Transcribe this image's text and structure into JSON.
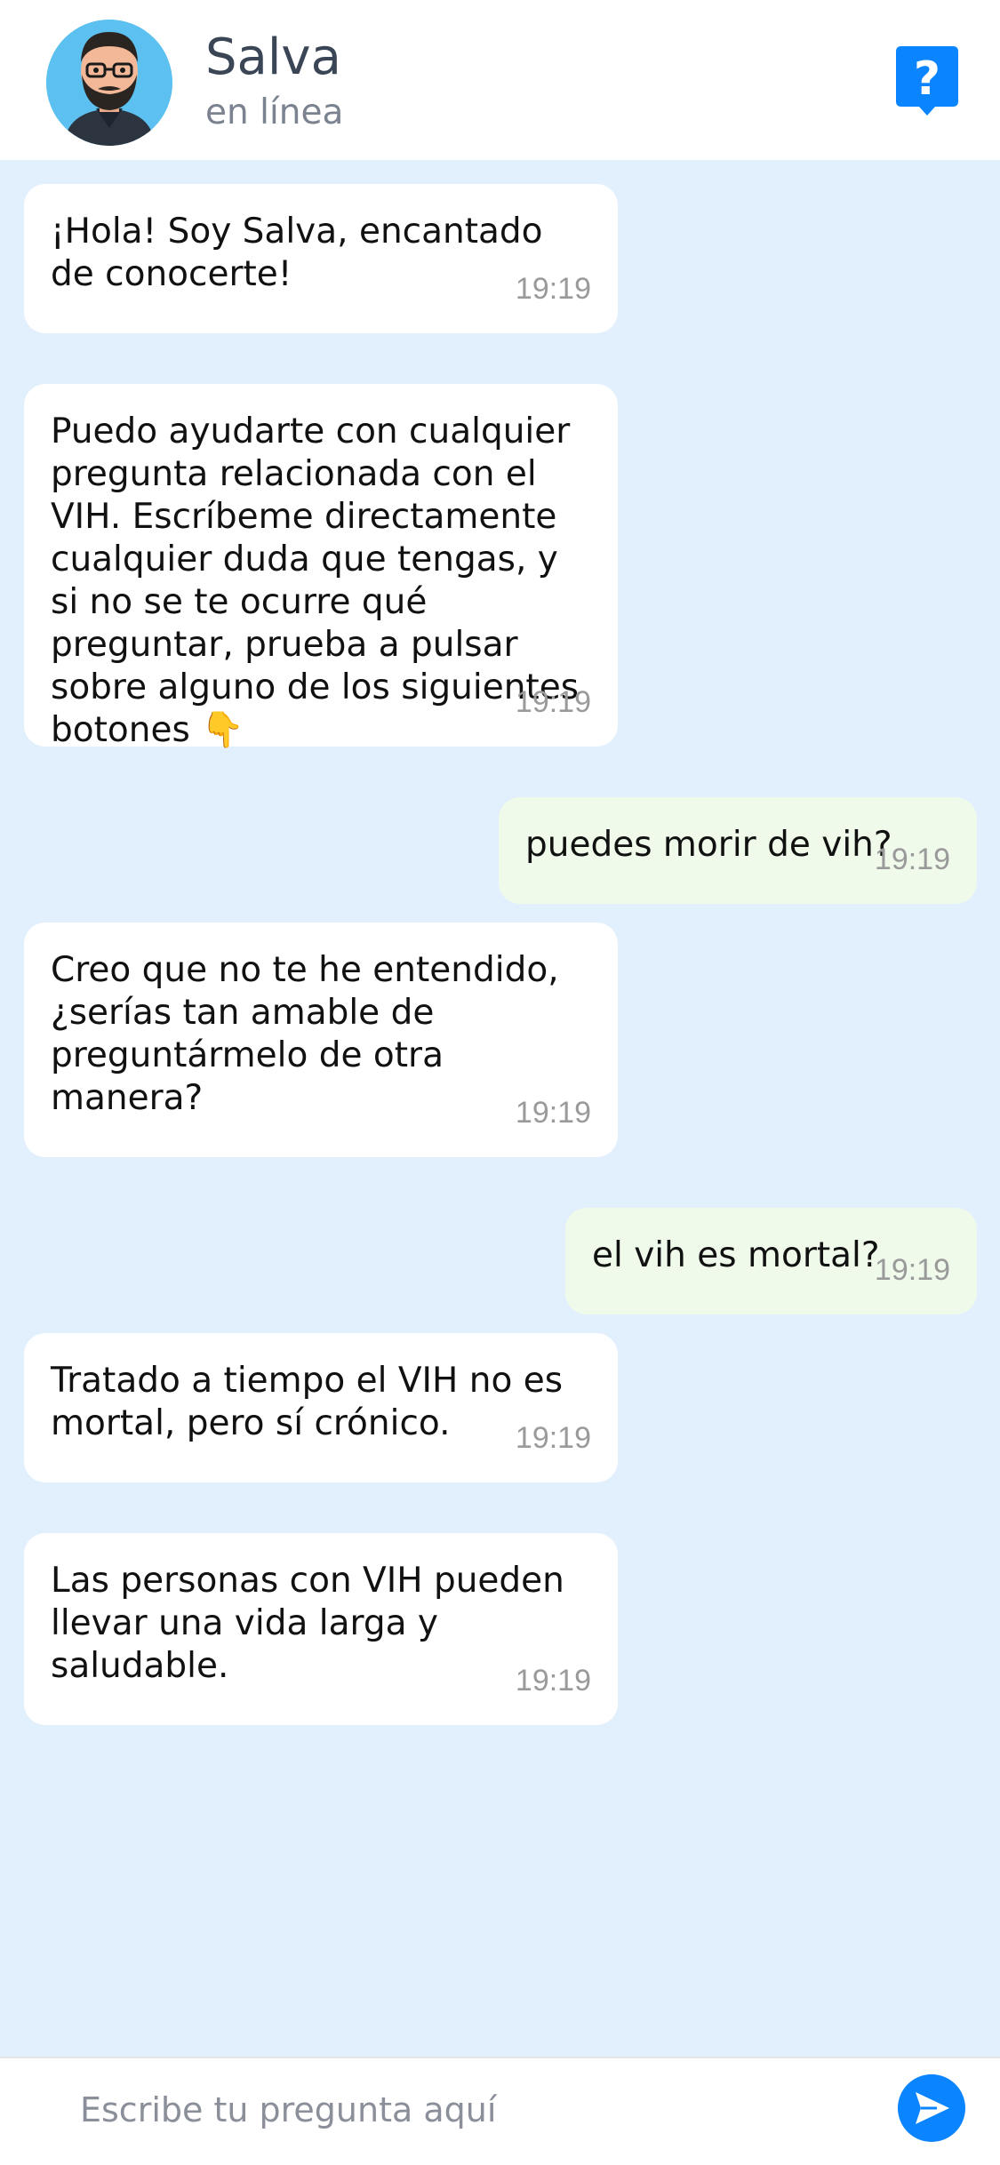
{
  "header": {
    "name": "Salva",
    "status": "en línea",
    "help_icon": "help-question-icon"
  },
  "messages": [
    {
      "from": "bot",
      "text": "¡Hola! Soy Salva, encantado de conocerte!",
      "time": "19:19"
    },
    {
      "from": "bot",
      "text": "Puedo ayudarte con cualquier pregunta relacionada con el VIH. Escríbeme directamente cualquier duda que tengas, y si no se te ocurre qué preguntar, prueba a pulsar sobre alguno de los siguientes botones 👇",
      "time": "19:19"
    },
    {
      "from": "user",
      "text": "puedes morir de vih?",
      "time": "19:19"
    },
    {
      "from": "bot",
      "text": "Creo que no te he entendido, ¿serías tan amable de preguntármelo de otra manera?",
      "time": "19:19"
    },
    {
      "from": "user",
      "text": "el vih es mortal?",
      "time": "19:19"
    },
    {
      "from": "bot",
      "text": "Tratado a tiempo el VIH no es mortal, pero sí crónico.",
      "time": "19:19"
    },
    {
      "from": "bot",
      "text": "Las personas con VIH pueden llevar una vida larga y saludable.",
      "time": "19:19"
    }
  ],
  "composer": {
    "placeholder": "Escribe tu pregunta aquí",
    "send_icon": "send-arrow-icon"
  },
  "colors": {
    "chat_background": "#e2effc",
    "bot_bubble": "#ffffff",
    "user_bubble": "#effaea",
    "accent": "#0a84ff"
  }
}
